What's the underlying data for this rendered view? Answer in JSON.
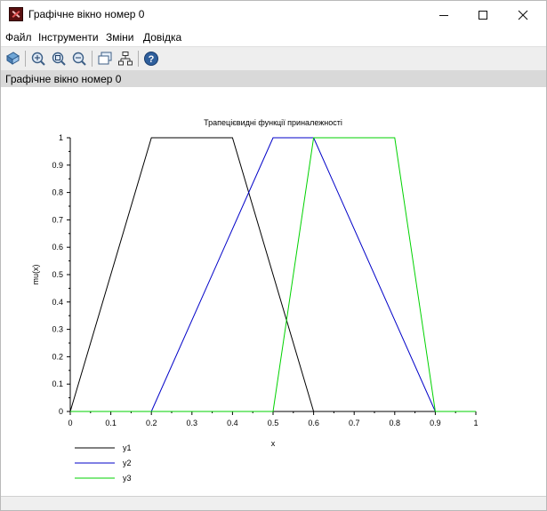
{
  "window": {
    "title": "Графічне вікно номер 0",
    "minimize_icon": "minimize-icon",
    "maximize_icon": "maximize-icon",
    "close_icon": "close-icon"
  },
  "menu": {
    "items": [
      "Файл",
      "Інструменти",
      "Зміни",
      "Довідка"
    ]
  },
  "toolbar": {
    "icons": [
      "rotate-icon",
      "zoom-in-icon",
      "zoom-reset-icon",
      "zoom-out-icon",
      "datatip-icon",
      "editor-icon",
      "help-icon"
    ]
  },
  "infobar": {
    "text": "Графічне вікно номер 0"
  },
  "chart_data": {
    "type": "line",
    "title": "Трапецієвидні функції приналежності",
    "xlabel": "x",
    "ylabel": "mu(x)",
    "xlim": [
      0,
      1
    ],
    "ylim": [
      0,
      1
    ],
    "xticks": [
      "0",
      "0.1",
      "0.2",
      "0.3",
      "0.4",
      "0.5",
      "0.6",
      "0.7",
      "0.8",
      "0.9",
      "1"
    ],
    "yticks": [
      "0",
      "0.1",
      "0.2",
      "0.3",
      "0.4",
      "0.5",
      "0.6",
      "0.7",
      "0.8",
      "0.9",
      "1"
    ],
    "grid": false,
    "legend_position": "bottom-left",
    "series": [
      {
        "name": "y1",
        "color": "#000000",
        "x": [
          0,
          0.2,
          0.4,
          0.6,
          1
        ],
        "y": [
          0,
          1,
          1,
          0,
          0
        ]
      },
      {
        "name": "y2",
        "color": "#0000c8",
        "x": [
          0,
          0.2,
          0.5,
          0.6,
          0.9,
          1
        ],
        "y": [
          0,
          0,
          1,
          1,
          0,
          0
        ]
      },
      {
        "name": "y3",
        "color": "#00d200",
        "x": [
          0,
          0.5,
          0.6,
          0.8,
          0.9,
          1
        ],
        "y": [
          0,
          0,
          1,
          1,
          0,
          0
        ]
      }
    ]
  }
}
